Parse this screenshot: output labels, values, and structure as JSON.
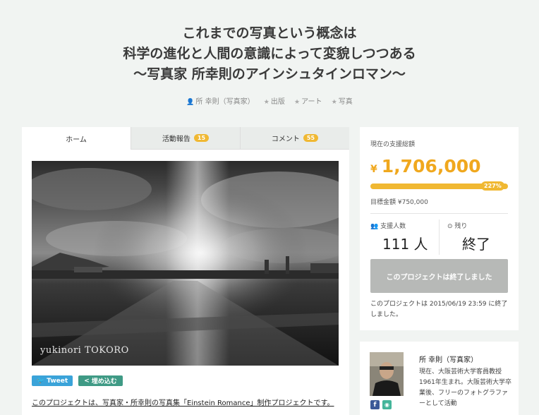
{
  "project": {
    "title_lines": [
      "これまでの写真という概念は",
      "科学の進化と人間の意識によって変貌しつつある",
      "〜写真家 所幸則のアインシュタインロマン〜"
    ],
    "meta": {
      "author": "所 幸則（写真家）",
      "tags": [
        "出版",
        "アート",
        "写真"
      ]
    }
  },
  "tabs": [
    {
      "label": "ホーム",
      "badge": null
    },
    {
      "label": "活動報告",
      "badge": "15"
    },
    {
      "label": "コメント",
      "badge": "55"
    }
  ],
  "hero": {
    "signature": "yukinori TOKORO"
  },
  "share": {
    "tweet_label": "Tweet",
    "embed_label": "埋め込む"
  },
  "intro_text": "このプロジェクトは、写真家・所幸則の写真集「Einstein Romance」制作プロジェクトです。",
  "funding": {
    "label": "現在の支援総額",
    "currency": "¥",
    "amount": "1,706,000",
    "percent_label": "227%",
    "progress_fraction": 1.0,
    "goal": "目標金額 ¥750,000",
    "supporters_label": "支援人数",
    "supporters_value": "111 人",
    "remaining_label": "残り",
    "remaining_value": "終了",
    "finished_button": "このプロジェクトは終了しました",
    "end_note": "このプロジェクトは 2015/06/19 23:59 に終了しました。"
  },
  "profile": {
    "name": "所 幸則（写真家）",
    "bio": "現在、大阪芸術大学客員教授1961年生まれ。大阪芸術大学卒業後、フリーのフォトグラファーとして活動"
  },
  "colors": {
    "accent": "#f0b832",
    "amount": "#f0a81e",
    "tweet": "#3aa3d9",
    "embed": "#3f9a85",
    "facebook": "#3b5998"
  }
}
